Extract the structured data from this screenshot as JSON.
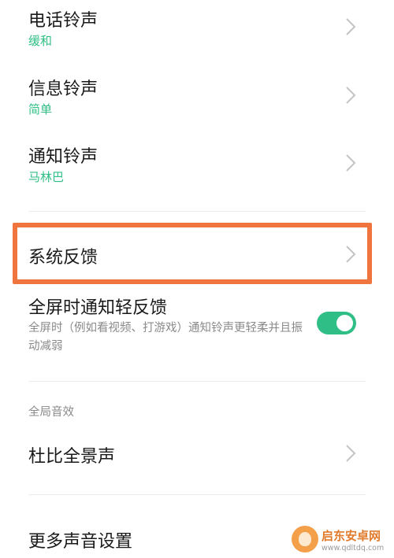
{
  "settings": {
    "phone_ringtone": {
      "title": "电话铃声",
      "value": "缓和"
    },
    "message_ringtone": {
      "title": "信息铃声",
      "value": "简单"
    },
    "notification_ringtone": {
      "title": "通知铃声",
      "value": "马林巴"
    },
    "system_feedback": {
      "title": "系统反馈"
    },
    "fullscreen_feedback": {
      "title": "全屏时通知轻反馈",
      "desc": "全屏时（例如看视频、打游戏）通知铃声更轻柔并且振动减弱",
      "enabled": true
    },
    "global_sound_section": "全局音效",
    "dolby_atmos": {
      "title": "杜比全景声"
    },
    "more_sound_settings": {
      "title": "更多声音设置"
    }
  },
  "colors": {
    "accent": "#2fbf86",
    "highlight_border": "#f0743e"
  },
  "watermark": {
    "name": "启东安卓网",
    "url": "www.qdltdq.com"
  }
}
